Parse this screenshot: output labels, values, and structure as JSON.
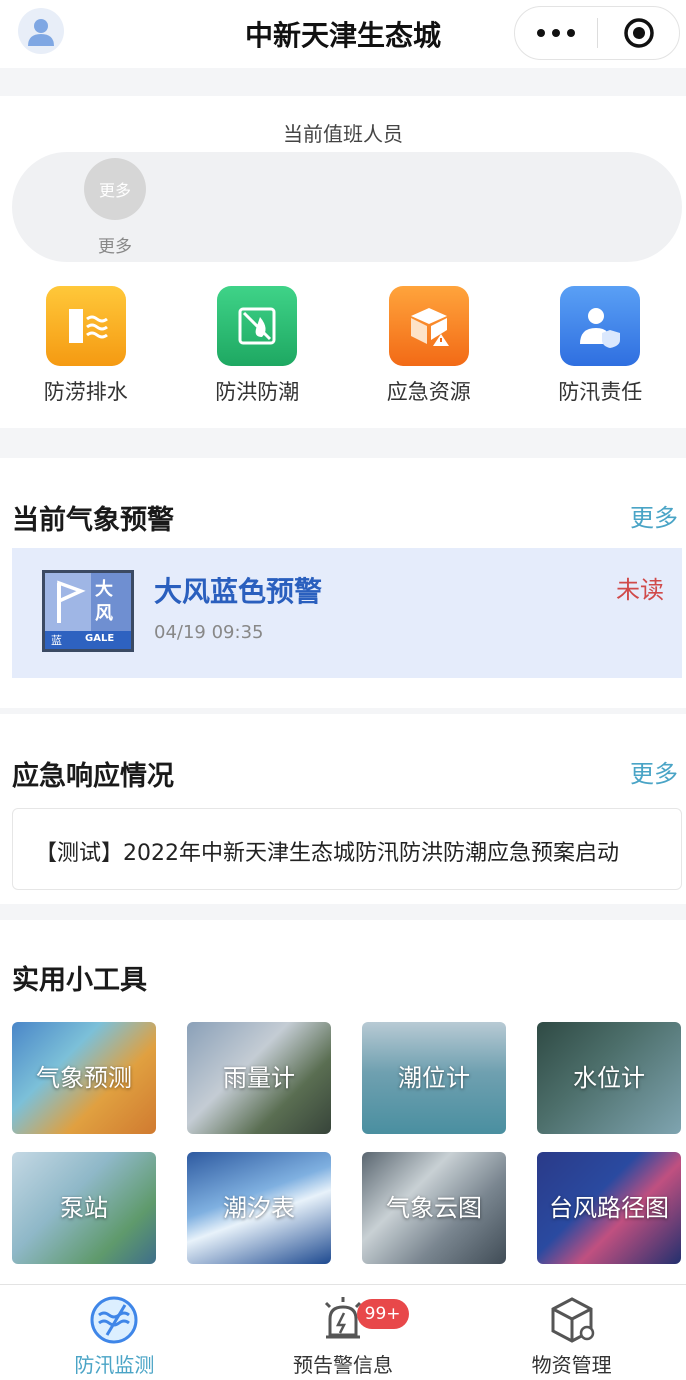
{
  "header": {
    "title": "中新天津生态城"
  },
  "duty": {
    "title": "当前值班人员",
    "avatar_text": "更多",
    "more_label": "更多"
  },
  "quick": [
    {
      "label": "防涝排水",
      "icon": "flood-drain-icon",
      "color": "#f5a623"
    },
    {
      "label": "防洪防潮",
      "icon": "flood-tide-icon",
      "color": "#2ebf74"
    },
    {
      "label": "应急资源",
      "icon": "emergency-box-icon",
      "color": "#f57d24"
    },
    {
      "label": "防汛责任",
      "icon": "responsibility-user-icon",
      "color": "#3f86e8"
    }
  ],
  "weather": {
    "title": "当前气象预警",
    "more": "更多",
    "badge_top": "大",
    "badge_mid": "风",
    "badge_color": "蓝",
    "badge_en": "GALE",
    "alert_title": "大风蓝色预警",
    "time": "04/19 09:35",
    "status": "未读"
  },
  "response": {
    "title": "应急响应情况",
    "more": "更多",
    "item": "【测试】2022年中新天津生态城防汛防洪防潮应急预案启动"
  },
  "tools": {
    "title": "实用小工具",
    "items": [
      "气象预测",
      "雨量计",
      "潮位计",
      "水位计",
      "泵站",
      "潮汐表",
      "气象云图",
      "台风路径图"
    ]
  },
  "tabbar": {
    "items": [
      "防汛监测",
      "预告警信息",
      "物资管理"
    ],
    "badge": "99+"
  },
  "colors": {
    "accent": "#4aa4c6",
    "warn_bg": "#e5ecfb",
    "badge_red": "#e8484a"
  }
}
